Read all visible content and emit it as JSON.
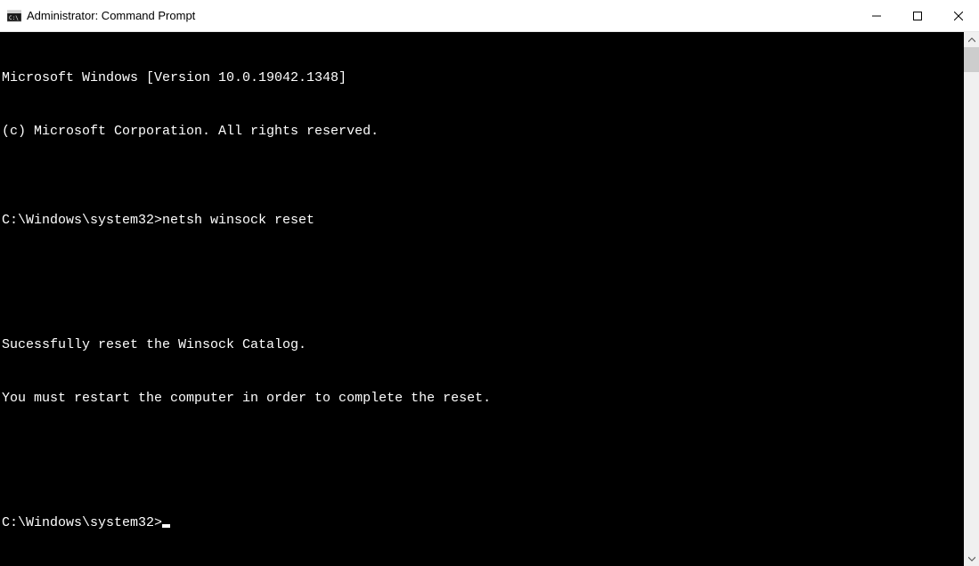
{
  "window": {
    "title": "Administrator: Command Prompt"
  },
  "terminal": {
    "lines": [
      "Microsoft Windows [Version 10.0.19042.1348]",
      "(c) Microsoft Corporation. All rights reserved.",
      "",
      "C:\\Windows\\system32>netsh winsock reset",
      "",
      "",
      "Sucessfully reset the Winsock Catalog.",
      "You must restart the computer in order to complete the reset.",
      "",
      ""
    ],
    "prompt": "C:\\Windows\\system32>"
  }
}
